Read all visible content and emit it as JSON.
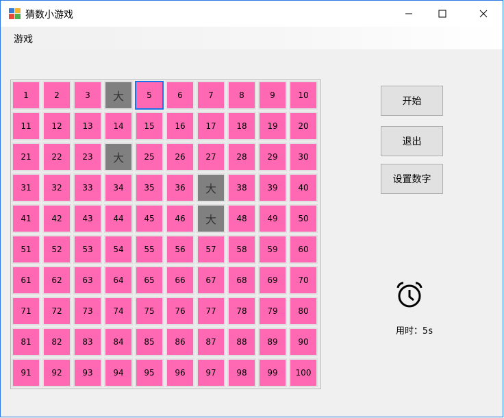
{
  "window": {
    "title": "猜数小游戏",
    "controls": {
      "minimize": "—",
      "maximize": "☐",
      "close": "✕"
    }
  },
  "menu": {
    "items": [
      "游戏"
    ]
  },
  "board": {
    "cells": [
      "1",
      "2",
      "3",
      "大",
      "5",
      "6",
      "7",
      "8",
      "9",
      "10",
      "11",
      "12",
      "13",
      "14",
      "15",
      "16",
      "17",
      "18",
      "19",
      "20",
      "21",
      "22",
      "23",
      "大",
      "25",
      "26",
      "27",
      "28",
      "29",
      "30",
      "31",
      "32",
      "33",
      "34",
      "35",
      "36",
      "大",
      "38",
      "39",
      "40",
      "41",
      "42",
      "43",
      "44",
      "45",
      "46",
      "大",
      "48",
      "49",
      "50",
      "51",
      "52",
      "53",
      "54",
      "55",
      "56",
      "57",
      "58",
      "59",
      "60",
      "61",
      "62",
      "63",
      "64",
      "65",
      "66",
      "67",
      "68",
      "69",
      "70",
      "71",
      "72",
      "73",
      "74",
      "75",
      "76",
      "77",
      "78",
      "79",
      "80",
      "81",
      "82",
      "83",
      "84",
      "85",
      "86",
      "87",
      "88",
      "89",
      "90",
      "91",
      "92",
      "93",
      "94",
      "95",
      "96",
      "97",
      "98",
      "99",
      "100"
    ],
    "guessed_indices": [
      3,
      23,
      36,
      46
    ],
    "selected_index": 4,
    "colors": {
      "cell": "#ff69b4",
      "guessed": "#808080",
      "selected_border": "#1a73e8"
    }
  },
  "buttons": {
    "start": "开始",
    "exit": "退出",
    "set_number": "设置数字"
  },
  "timer": {
    "label": "用时：5s",
    "icon": "alarm-clock-icon"
  }
}
